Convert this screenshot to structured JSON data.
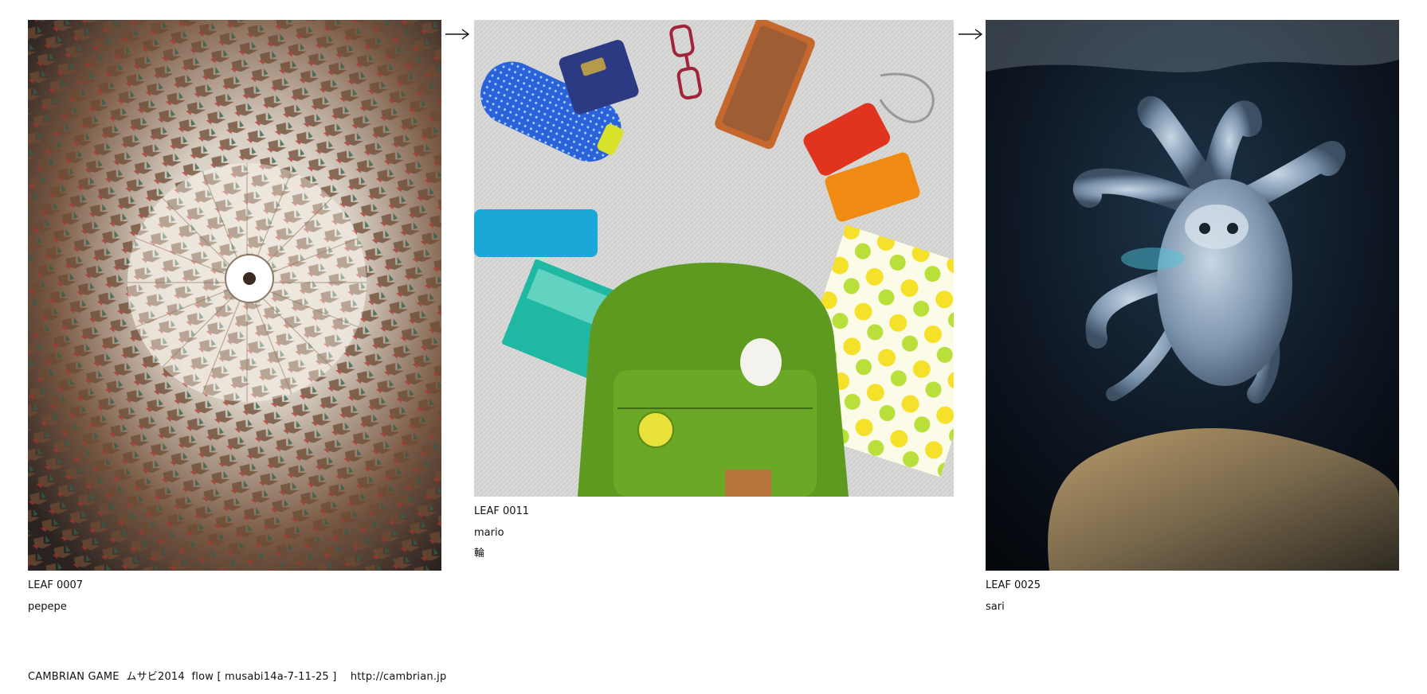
{
  "leaves": [
    {
      "id": "LEAF 0007",
      "author": "pepepe",
      "note": "",
      "photo_subject": "origami-cranes-umbrella"
    },
    {
      "id": "LEAF 0011",
      "author": "mario",
      "note": "輪",
      "photo_subject": "bag-contents-flatlay"
    },
    {
      "id": "LEAF 0025",
      "author": "sari",
      "note": "",
      "photo_subject": "octopus-aquarium"
    }
  ],
  "arrows": [
    "arrow-right-icon",
    "arrow-right-icon"
  ],
  "footer": {
    "text": "CAMBRIAN GAME  ムサビ2014  flow [ musabi14a-7-11-25 ]    http://cambrian.jp"
  },
  "colors": {
    "background": "#ffffff",
    "text": "#111111"
  }
}
